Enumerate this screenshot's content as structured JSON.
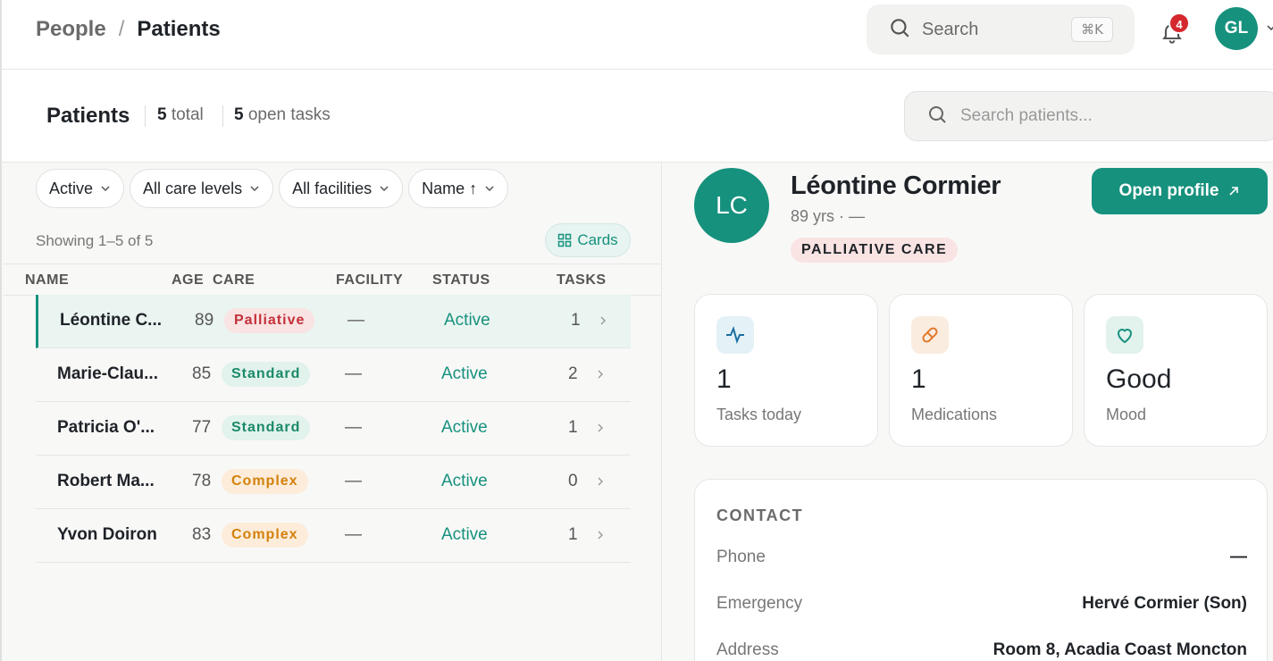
{
  "breadcrumb": {
    "parent": "People",
    "separator": "/",
    "current": "Patients"
  },
  "global_search": {
    "placeholder": "Search",
    "shortcut": "⌘K"
  },
  "notifications": {
    "count": "4"
  },
  "user": {
    "initials": "GL"
  },
  "header": {
    "title": "Patients",
    "total_count": "5",
    "total_label": "total",
    "tasks_count": "5",
    "tasks_label": "open tasks",
    "search_placeholder": "Search patients..."
  },
  "filters": [
    {
      "label": "Active"
    },
    {
      "label": "All care levels"
    },
    {
      "label": "All facilities"
    },
    {
      "label": "Name ↑"
    }
  ],
  "list": {
    "showing": "Showing 1–5 of 5",
    "view_toggle": "Cards",
    "columns": {
      "name": "NAME",
      "age": "AGE",
      "care": "CARE",
      "facility": "FACILITY",
      "status": "STATUS",
      "tasks": "TASKS"
    },
    "rows": [
      {
        "name": "Léontine C...",
        "age": "89",
        "care": "Palliative",
        "facility": "—",
        "status": "Active",
        "tasks": "1"
      },
      {
        "name": "Marie-Clau...",
        "age": "85",
        "care": "Standard",
        "facility": "—",
        "status": "Active",
        "tasks": "2"
      },
      {
        "name": "Patricia O'...",
        "age": "77",
        "care": "Standard",
        "facility": "—",
        "status": "Active",
        "tasks": "1"
      },
      {
        "name": "Robert Ma...",
        "age": "78",
        "care": "Complex",
        "facility": "—",
        "status": "Active",
        "tasks": "0"
      },
      {
        "name": "Yvon Doiron",
        "age": "83",
        "care": "Complex",
        "facility": "—",
        "status": "Active",
        "tasks": "1"
      }
    ]
  },
  "detail": {
    "initials": "LC",
    "name": "Léontine Cormier",
    "meta": "89 yrs · —",
    "care_badge": "PALLIATIVE CARE",
    "open_button": "Open profile",
    "stats": [
      {
        "value": "1",
        "label": "Tasks today",
        "icon": "activity-icon"
      },
      {
        "value": "1",
        "label": "Medications",
        "icon": "pill-icon"
      },
      {
        "value": "Good",
        "label": "Mood",
        "icon": "heart-icon"
      }
    ],
    "contact": {
      "heading": "CONTACT",
      "phone_label": "Phone",
      "phone_value": "—",
      "emergency_label": "Emergency",
      "emergency_value": "Hervé Cormier (Son)",
      "address_label": "Address",
      "address_value": "Room 8, Acadia Coast Moncton"
    }
  },
  "colors": {
    "accent": "#16917d",
    "palliative": "#c4313a",
    "standard": "#1a8a68",
    "complex": "#d4810c",
    "notification": "#d4282e"
  }
}
